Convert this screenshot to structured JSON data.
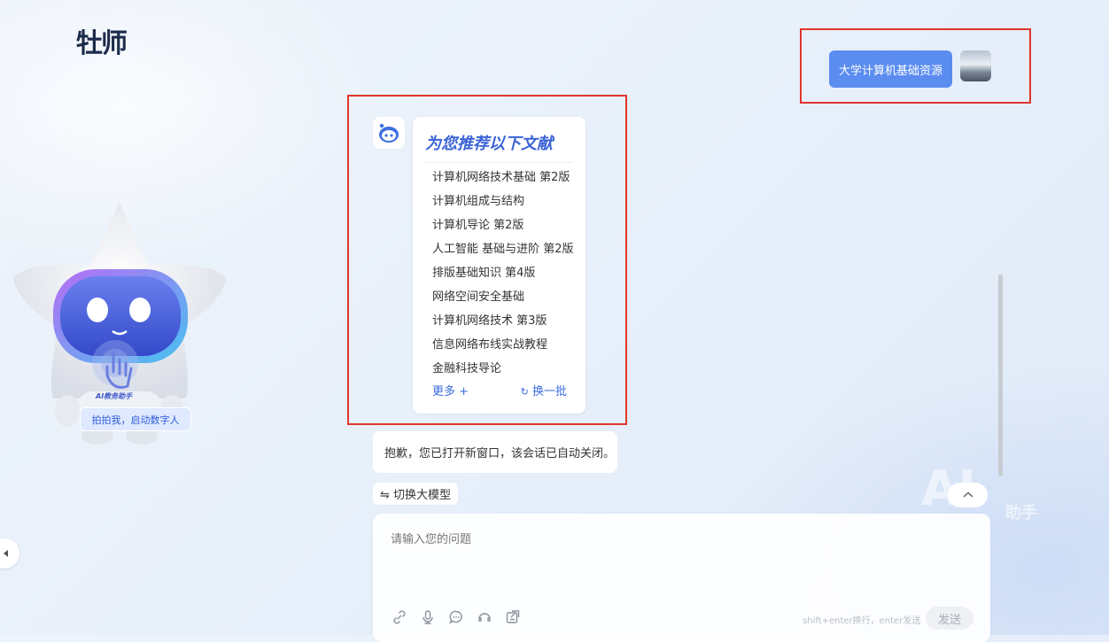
{
  "brand": {
    "logo_text": "牡师"
  },
  "user_message": {
    "text": "大学计算机基础资源"
  },
  "recommendation_card": {
    "title": "为您推荐以下文献",
    "books": [
      "计算机网络技术基础 第2版",
      "计算机组成与结构",
      "计算机导论 第2版",
      "人工智能 基础与进阶 第2版",
      "排版基础知识 第4版",
      "网络空间安全基础",
      "计算机网络技术 第3版",
      "信息网络布线实战教程",
      "金融科技导论"
    ],
    "more_label": "更多 +",
    "refresh_label": "换一批"
  },
  "notice": {
    "text": "抱歉，您已打开新窗口，该会话已自动关闭。"
  },
  "switch_model": {
    "label": "⇋ 切换大模型"
  },
  "composer": {
    "placeholder": "请输入您的问题",
    "hint": "shift+enter换行，enter发送",
    "send_label": "发送"
  },
  "digital_human": {
    "badge_text": "AI教务助手",
    "start_label": "拍拍我，启动数字人"
  },
  "decor": {
    "ai_text": "AI",
    "assistant_text": "助手"
  },
  "colors": {
    "accent": "#5b8cf0",
    "link": "#3a6de0",
    "title": "#3a63d6"
  },
  "icons": [
    "link-icon",
    "microphone-icon",
    "chat-icon",
    "headset-icon",
    "share-icon",
    "chevron-up-icon",
    "refresh-icon",
    "caret-left-icon"
  ]
}
